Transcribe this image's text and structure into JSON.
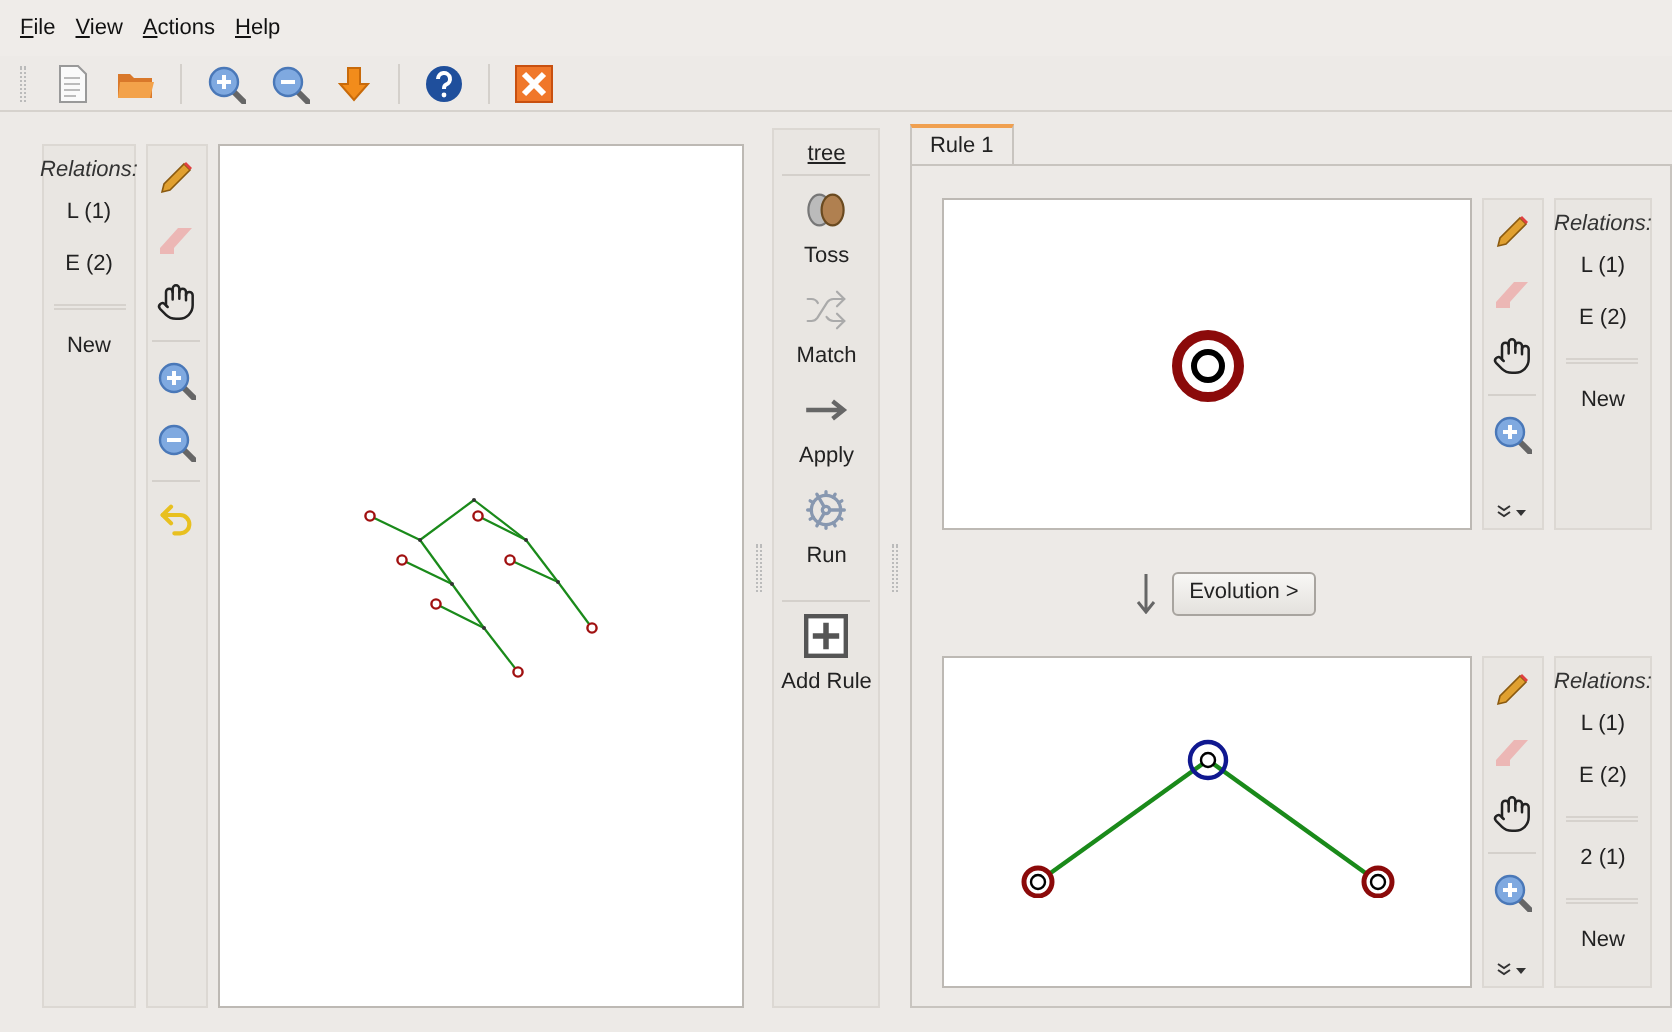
{
  "menu": [
    {
      "label": "File"
    },
    {
      "label": "View"
    },
    {
      "label": "Actions"
    },
    {
      "label": "Help"
    }
  ],
  "toolbar": [
    {
      "kind": "document"
    },
    {
      "kind": "folder"
    },
    {
      "kind": "separator"
    },
    {
      "kind": "zoom-in"
    },
    {
      "kind": "zoom-out"
    },
    {
      "kind": "download"
    },
    {
      "kind": "separator"
    },
    {
      "kind": "help"
    },
    {
      "kind": "separator"
    },
    {
      "kind": "close"
    }
  ],
  "host": {
    "relations": {
      "title": "Relations:",
      "groups": [
        [
          "L (1)",
          "E (2)"
        ],
        [
          "New"
        ]
      ]
    },
    "tools": [
      {
        "kind": "pencil",
        "disabled": false
      },
      {
        "kind": "eraser",
        "disabled": true
      },
      {
        "kind": "hand",
        "disabled": false
      },
      {
        "kind": "separator"
      },
      {
        "kind": "zoom-in",
        "disabled": false
      },
      {
        "kind": "zoom-out",
        "disabled": false
      },
      {
        "kind": "separator"
      },
      {
        "kind": "undo",
        "disabled": false
      }
    ]
  },
  "actions": {
    "link": "tree",
    "items": [
      {
        "kind": "coins",
        "label": "Toss"
      },
      {
        "kind": "shuffle",
        "label": "Match"
      },
      {
        "kind": "arrow",
        "label": "Apply"
      },
      {
        "kind": "gears",
        "label": "Run"
      },
      {
        "kind": "separator"
      },
      {
        "kind": "add",
        "label": "Add Rule"
      }
    ]
  },
  "tabs": [
    {
      "label": "Rule 1",
      "selected": true
    }
  ],
  "rule": {
    "left": {
      "tools": [
        {
          "kind": "pencil",
          "disabled": false
        },
        {
          "kind": "eraser",
          "disabled": true
        },
        {
          "kind": "hand",
          "disabled": false
        },
        {
          "kind": "separator"
        },
        {
          "kind": "zoom-in",
          "disabled": false
        }
      ],
      "relations": {
        "title": "Relations:",
        "groups": [
          [
            "L (1)",
            "E (2)"
          ],
          [
            "New"
          ]
        ]
      }
    },
    "evolution_button": "Evolution >",
    "right": {
      "tools": [
        {
          "kind": "pencil",
          "disabled": false
        },
        {
          "kind": "eraser",
          "disabled": true
        },
        {
          "kind": "hand",
          "disabled": false
        },
        {
          "kind": "separator"
        },
        {
          "kind": "zoom-in",
          "disabled": false
        }
      ],
      "relations": {
        "title": "Relations:",
        "groups": [
          [
            "L (1)",
            "E (2)"
          ],
          [
            "2 (1)"
          ],
          [
            "New"
          ]
        ]
      }
    }
  }
}
